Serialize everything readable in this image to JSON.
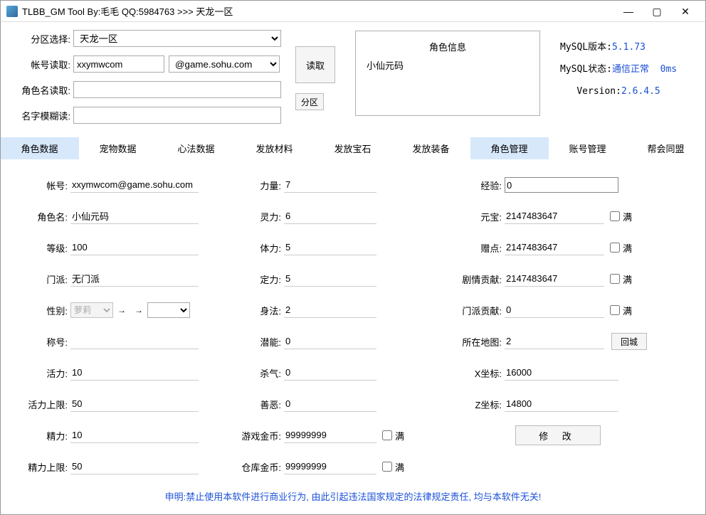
{
  "window": {
    "title": "TLBB_GM Tool By:毛毛 QQ:5984763 >>> 天龙一区"
  },
  "top": {
    "zone_label": "分区选择:",
    "zone_value": "天龙一区",
    "account_label": "帐号读取:",
    "account_value": "xxymwcom",
    "domain_value": "@game.sohu.com",
    "charname_label": "角色名读取:",
    "charname_value": "",
    "fuzzy_label": "名字模糊读:",
    "fuzzy_value": "",
    "read_btn": "读取",
    "zone_btn": "分区"
  },
  "rolebox": {
    "header": "角色信息",
    "item0": "小仙元码"
  },
  "info": {
    "mysql_ver_k": "MySQL版本:",
    "mysql_ver_v": "5.1.73",
    "mysql_stat_k": "MySQL状态:",
    "mysql_stat_v": "通信正常",
    "mysql_stat_ms": "0ms",
    "ver_k": "Version:",
    "ver_v": "2.6.4.5"
  },
  "tabs": {
    "t0": "角色数据",
    "t1": "宠物数据",
    "t2": "心法数据",
    "t3": "发放材料",
    "t4": "发放宝石",
    "t5": "发放装备",
    "t6": "角色管理",
    "t7": "账号管理",
    "t8": "帮会同盟"
  },
  "form": {
    "account_l": "帐号:",
    "account_v": "xxymwcom@game.sohu.com",
    "charname_l": "角色名:",
    "charname_v": "小仙元码",
    "level_l": "等级:",
    "level_v": "100",
    "faction_l": "门派:",
    "faction_v": "无门派",
    "gender_l": "性别:",
    "gender_v": "萝莉",
    "title_l": "称号:",
    "title_v": "",
    "energy_l": "活力:",
    "energy_v": "10",
    "energymax_l": "活力上限:",
    "energymax_v": "50",
    "vigor_l": "精力:",
    "vigor_v": "10",
    "vigormax_l": "精力上限:",
    "vigormax_v": "50",
    "str_l": "力量:",
    "str_v": "7",
    "spi_l": "灵力:",
    "spi_v": "6",
    "con_l": "体力:",
    "con_v": "5",
    "res_l": "定力:",
    "res_v": "5",
    "agi_l": "身法:",
    "agi_v": "2",
    "pot_l": "潜能:",
    "pot_v": "0",
    "kill_l": "杀气:",
    "kill_v": "0",
    "moral_l": "善恶:",
    "moral_v": "0",
    "gold_l": "游戏金币:",
    "gold_v": "99999999",
    "bank_l": "仓库金币:",
    "bank_v": "99999999",
    "exp_l": "经验:",
    "exp_v": "0",
    "yuanbao_l": "元宝:",
    "yuanbao_v": "2147483647",
    "gift_l": "赠点:",
    "gift_v": "2147483647",
    "story_l": "剧情贡献:",
    "story_v": "2147483647",
    "factionc_l": "门派贡献:",
    "factionc_v": "0",
    "map_l": "所在地图:",
    "map_v": "2",
    "xcoord_l": "X坐标:",
    "xcoord_v": "16000",
    "zcoord_l": "Z坐标:",
    "zcoord_v": "14800",
    "full": "满",
    "home_btn": "回城",
    "modify_btn": "修 改"
  },
  "footer": "申明:禁止使用本软件进行商业行为, 由此引起违法国家规定的法律规定责任, 均与本软件无关!"
}
